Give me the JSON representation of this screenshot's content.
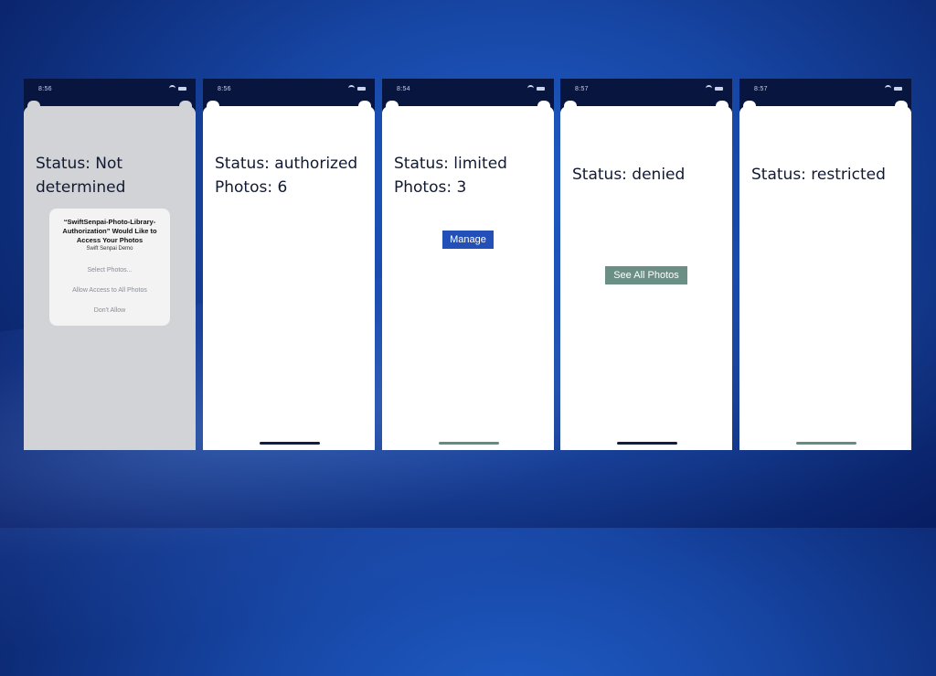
{
  "screens": [
    {
      "time": "8:56",
      "status_line1": "Status: Not",
      "status_line2": "determined",
      "alert": {
        "title_line1": "“SwiftSenpai-Photo-Library-",
        "title_line2": "Authorization” Would Like to",
        "title_line3": "Access Your Photos",
        "subtitle": "Swift Senpai Demo",
        "options": [
          "Select Photos...",
          "Allow Access to All Photos",
          "Don't Allow"
        ]
      }
    },
    {
      "time": "8:56",
      "status_line1": "Status: authorized",
      "status_line2": "Photos: 6"
    },
    {
      "time": "8:54",
      "status_line1": "Status: limited",
      "status_line2": "Photos: 3",
      "button_label": "Manage"
    },
    {
      "time": "8:57",
      "status_line1": "Status: denied",
      "button_label": "See All Photos"
    },
    {
      "time": "8:57",
      "status_line1": "Status: restricted"
    }
  ],
  "colors": {
    "background": "#1747a6",
    "manage_button": "#2250b8",
    "see_all_button": "#6b8f84",
    "dimmed_sheet": "#d2d3d6"
  }
}
